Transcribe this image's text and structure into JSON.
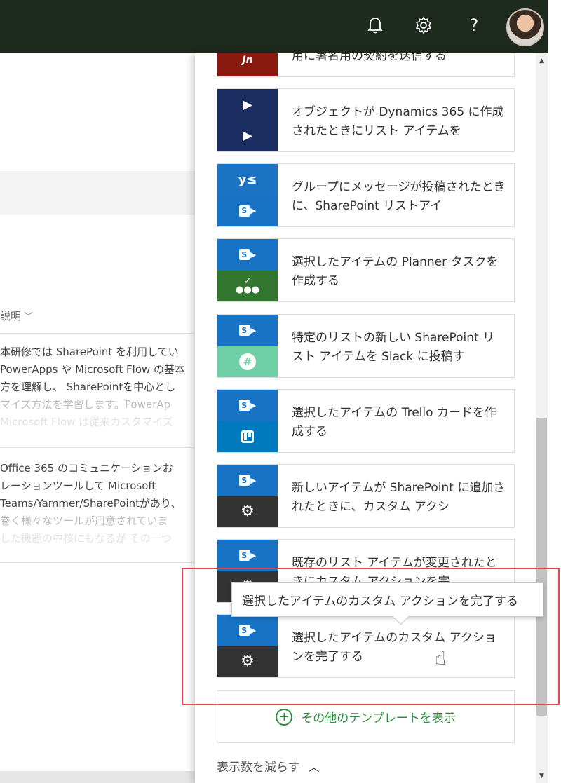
{
  "topbar": {
    "bell_icon": "bell-icon",
    "gear_icon": "gear-icon",
    "help_label": "?"
  },
  "background": {
    "description_header": "説明",
    "item1_lines": [
      "本研修では SharePoint を利用してい",
      "PowerApps や Microsoft Flow の基本",
      "方を理解し、 SharePointを中心とし",
      "マイズ方法を学習します。PowerAp",
      "Microsoft Flow は従来カスタマイズ"
    ],
    "item2_lines": [
      "Office 365 のコミュニケーションお",
      "レーションツールして Microsoft",
      "Teams/Yammer/SharePointがあり、",
      "巻く様々なツールが用意されていま",
      "した機能の中核にもなるが その一つ"
    ]
  },
  "templates": [
    {
      "text": "用に署名用の契約を送信する",
      "tiles": [
        "acrobat-sign"
      ]
    },
    {
      "text": "オブジェクトが Dynamics 365 に作成されたときにリスト アイテムを",
      "tiles": [
        "dynamics",
        "dynamics"
      ]
    },
    {
      "text": "グループにメッセージが投稿されたときに、SharePoint リストアイ",
      "tiles": [
        "yammer",
        "sharepoint"
      ]
    },
    {
      "text": "選択したアイテムの Planner タスクを作成する",
      "tiles": [
        "sharepoint",
        "planner"
      ]
    },
    {
      "text": "特定のリストの新しい SharePoint リスト アイテムを Slack に投稿す",
      "tiles": [
        "sharepoint",
        "slack"
      ]
    },
    {
      "text": "選択したアイテムの Trello カードを作成する",
      "tiles": [
        "sharepoint",
        "trello"
      ]
    },
    {
      "text": "新しいアイテムが SharePoint に追加されたときに、カスタム アクシ",
      "tiles": [
        "sharepoint",
        "gear"
      ]
    },
    {
      "text": "既存のリスト アイテムが変更されたときにカスタム アクションを完",
      "tiles": [
        "sharepoint",
        "gear"
      ]
    },
    {
      "text": "選択したアイテムのカスタム アクションを完了する",
      "tiles": [
        "sharepoint",
        "gear"
      ]
    }
  ],
  "tooltip": "選択したアイテムのカスタム アクションを完了する",
  "more_templates": "その他のテンプレートを表示",
  "show_less": "表示数を減らす",
  "colors": {
    "topbar": "#1f2a1f",
    "sharepoint": "#1873c4",
    "accent_green": "#2e8b3e",
    "highlight": "#e0474f"
  }
}
